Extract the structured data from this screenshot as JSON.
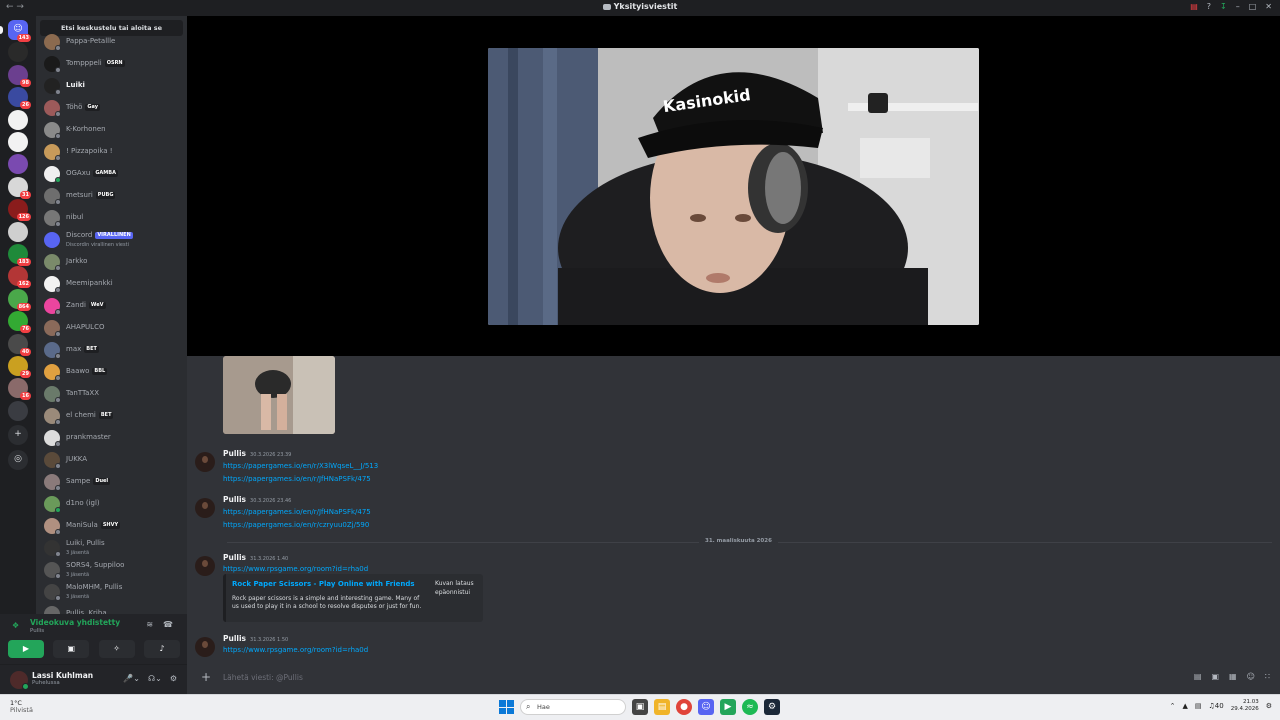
{
  "window": {
    "title": "Yksityisviestit",
    "nav_icons": "← →"
  },
  "titlebar_icons": [
    "inbox-icon",
    "help-icon",
    "download-icon",
    "minimize-icon",
    "maximize-icon",
    "close-icon"
  ],
  "sidebar": {
    "search_placeholder": "Etsi keskustelu tai aloita se",
    "dms": [
      {
        "name": "Pappa-Petallle",
        "tag": "",
        "status": "off",
        "color": "#8b6a4f"
      },
      {
        "name": "Tompppeli",
        "tag": "OSRN",
        "status": "off",
        "color": "#1a1a1a"
      },
      {
        "name": "Luiki",
        "tag": "",
        "status": "off",
        "color": "#222222",
        "bold": true
      },
      {
        "name": "Töhö",
        "tag": "Gay",
        "status": "off",
        "color": "#9c5a5a"
      },
      {
        "name": "K-Korhonen",
        "tag": "",
        "status": "off",
        "color": "#8a8a8a"
      },
      {
        "name": "! Pizzapoika !",
        "tag": "",
        "status": "off",
        "color": "#c79a5a"
      },
      {
        "name": "OGAxu",
        "tag": "GAMBA",
        "status": "on",
        "color": "#efefef"
      },
      {
        "name": "metsuri",
        "tag": "PUBG",
        "status": "off",
        "color": "#6e6e6e"
      },
      {
        "name": "nibul",
        "tag": "",
        "status": "off",
        "color": "#777777"
      },
      {
        "name": "Discord",
        "tag": "VIRALLINEN",
        "status": "official",
        "color": "#5865f2",
        "sub": "Discordin virallinen viesti"
      },
      {
        "name": "Jarkko",
        "tag": "",
        "status": "off",
        "color": "#7a8a6a"
      },
      {
        "name": "Meemipankki",
        "tag": "",
        "status": "off",
        "color": "#f2f2f2"
      },
      {
        "name": "Zandi",
        "tag": "WeV",
        "status": "off",
        "color": "#eb459e"
      },
      {
        "name": "AHAPULCO",
        "tag": "",
        "status": "off",
        "color": "#8a6a5a"
      },
      {
        "name": "max",
        "tag": "BET",
        "status": "off",
        "color": "#5a6a8a"
      },
      {
        "name": "Baawo",
        "tag": "BBL",
        "status": "off",
        "color": "#e0a040"
      },
      {
        "name": "TanTTaXX",
        "tag": "",
        "status": "off",
        "color": "#6a7a6a"
      },
      {
        "name": "el chemi",
        "tag": "BET",
        "status": "off",
        "color": "#9a8a7a"
      },
      {
        "name": "prankmaster",
        "tag": "",
        "status": "off",
        "color": "#dcdcdc"
      },
      {
        "name": "JUKKA",
        "tag": "",
        "status": "off",
        "color": "#5a4a3a"
      },
      {
        "name": "Sampe",
        "tag": "Duel",
        "status": "off",
        "color": "#8a7a7a"
      },
      {
        "name": "d1no (igl)",
        "tag": "",
        "status": "on",
        "color": "#6a9a5a"
      },
      {
        "name": "ManiSula",
        "tag": "SHVY",
        "status": "off",
        "color": "#b09080"
      },
      {
        "name": "Luiki, Pullis",
        "tag": "",
        "status": "off",
        "color": "#333333",
        "sub": "3 jäsentä"
      },
      {
        "name": "SORS4, Suppiloo",
        "tag": "",
        "status": "off",
        "color": "#555555",
        "sub": "3 jäsentä"
      },
      {
        "name": "MaloMHM, Pullis",
        "tag": "",
        "status": "off",
        "color": "#444444",
        "sub": "3 jäsentä"
      },
      {
        "name": "Pullis, Kriba",
        "tag": "",
        "status": "off",
        "color": "#666666"
      }
    ]
  },
  "servers": [
    {
      "badge": "143",
      "color": "#5865f2",
      "home": true
    },
    {
      "badge": "",
      "color": "#2a2a2a"
    },
    {
      "badge": "98",
      "color": "#6b3f8f"
    },
    {
      "badge": "26",
      "color": "#3a4aa0"
    },
    {
      "badge": "",
      "color": "#f2f2f2"
    },
    {
      "badge": "",
      "color": "#f2f2f2"
    },
    {
      "badge": "",
      "color": "#7a4ab0"
    },
    {
      "badge": "31",
      "color": "#d8d8d8"
    },
    {
      "badge": "126",
      "color": "#8a1c1c"
    },
    {
      "badge": "",
      "color": "#cfcfcf"
    },
    {
      "badge": "183",
      "color": "#1f8a3a"
    },
    {
      "badge": "162",
      "color": "#b33636"
    },
    {
      "badge": "864",
      "color": "#4aa84a"
    },
    {
      "badge": "76",
      "color": "#33aa33"
    },
    {
      "badge": "40",
      "color": "#4a4a4a"
    },
    {
      "badge": "29",
      "color": "#caa020"
    },
    {
      "badge": "16",
      "color": "#8a6a6a"
    },
    {
      "badge": "",
      "color": "#3a3c42"
    }
  ],
  "voice": {
    "title": "Videokuva yhdistetty",
    "subtitle": "Pullis"
  },
  "user": {
    "name": "Lassi Kuhlman",
    "status": "Puhelussa"
  },
  "chat": {
    "messages": [
      {
        "author": "Pullis",
        "time": "30.3.2026 23.39",
        "links": [
          "https://papergames.io/en/r/X3lWqseL__J/513",
          "https://papergames.io/en/r/JfHNaPSFk/475"
        ]
      },
      {
        "author": "Pullis",
        "time": "30.3.2026 23.46",
        "links": [
          "https://papergames.io/en/r/JfHNaPSFk/475",
          "https://papergames.io/en/r/czryuu0Zj/590"
        ]
      },
      {
        "author": "Pullis",
        "time": "31.3.2026 1.40",
        "links": [
          "https://www.rpsgame.org/room?id=rha0d"
        ]
      },
      {
        "author": "Pullis",
        "time": "31.3.2026 1.50",
        "links": [
          "https://www.rpsgame.org/room?id=rha0d"
        ]
      }
    ],
    "date_divider": "31. maaliskuuta 2026",
    "embed": {
      "title": "Rock Paper Scissors - Play Online with Friends",
      "description": "Rock paper scissors is a simple and interesting game. Many of us used to play it in a school to resolve disputes or just for fun.",
      "image_alt": "Kuvan lataus epäonnistui"
    },
    "composer_placeholder": "Lähetä viesti: @Pullis"
  },
  "taskbar": {
    "weather_temp": "1°C",
    "weather_desc": "Pilvistä",
    "search_placeholder": "Hae",
    "time": "21.03",
    "date": "29.4.2026",
    "notif_count": "1",
    "volume": "40"
  }
}
